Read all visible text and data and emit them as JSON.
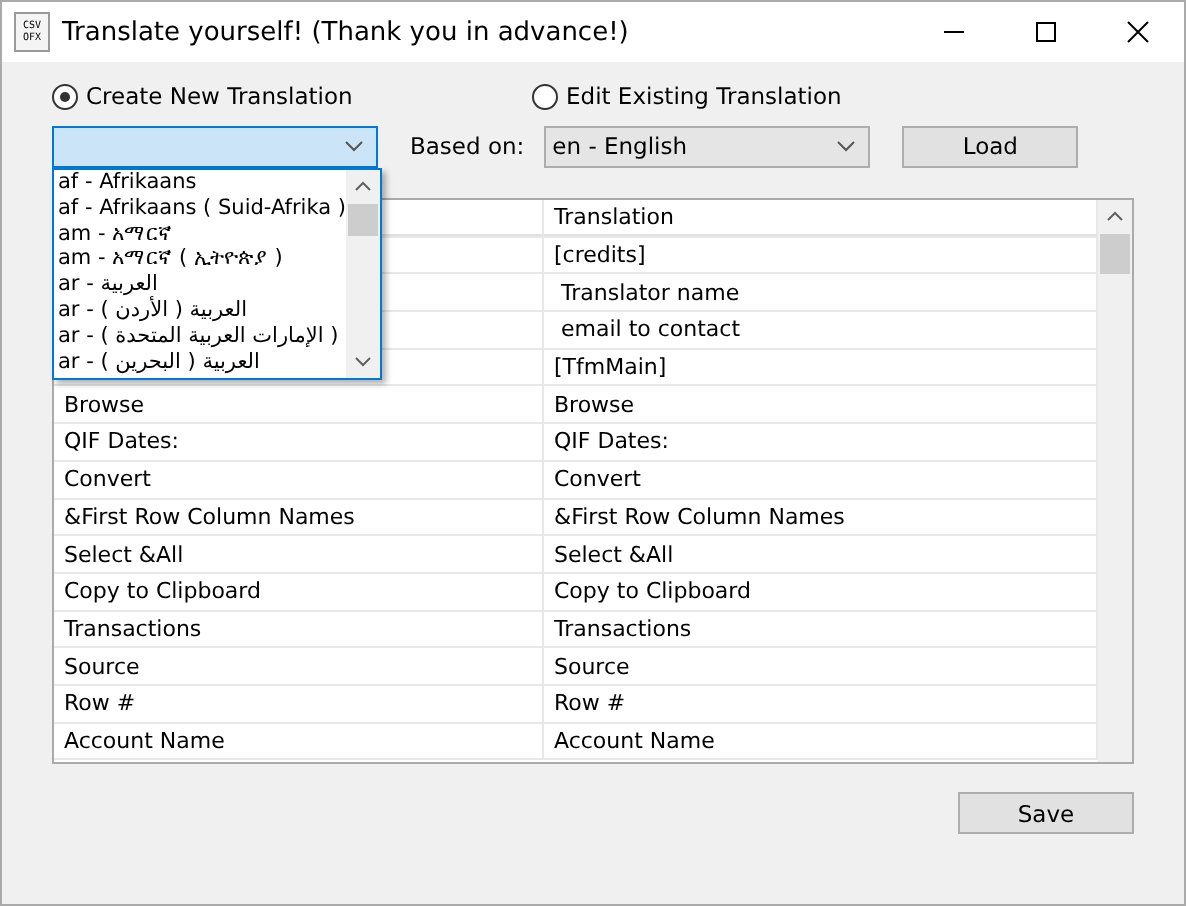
{
  "window": {
    "title": "Translate yourself! (Thank you in advance!)",
    "icon_lines": [
      "CSV",
      "OFX"
    ]
  },
  "modes": [
    {
      "label": "Create New Translation",
      "selected": true
    },
    {
      "label": "Edit Existing Translation",
      "selected": false
    }
  ],
  "new_language": {
    "expanded": true,
    "options": [
      {
        "label": "af - Afrikaans"
      },
      {
        "label": "af - Afrikaans ( Suid-Afrika )"
      },
      {
        "label": "am - አማርኛ"
      },
      {
        "label": "am - አማርኛ ( ኢትዮጵያ )"
      },
      {
        "label": "ar - العربية"
      },
      {
        "label": "ar - العربية ( الأردن )"
      },
      {
        "label": "ar - ( الإمارات العربية المتحدة )"
      },
      {
        "label": "ar - العربية ( البحرين )"
      }
    ]
  },
  "based_on": {
    "label": "Based on:",
    "value": "en - English"
  },
  "load_button": "Load",
  "table": {
    "columns": [
      "Translation"
    ],
    "rows": [
      {
        "translation": "[credits]"
      },
      {
        "translation": " Translator name"
      },
      {
        "translation": " email to contact"
      },
      {
        "translation": "[TfmMain]"
      },
      {
        "original": "Browse",
        "translation": "Browse"
      },
      {
        "original": "QIF Dates:",
        "translation": "QIF Dates:"
      },
      {
        "original": "Convert",
        "translation": "Convert"
      },
      {
        "original": "&First Row Column Names",
        "translation": "&First Row Column Names"
      },
      {
        "original": "Select &All",
        "translation": "Select &All"
      },
      {
        "original": "Copy to Clipboard",
        "translation": "Copy to Clipboard"
      },
      {
        "original": "Transactions",
        "translation": "Transactions"
      },
      {
        "original": "Source",
        "translation": "Source"
      },
      {
        "original": "Row #",
        "translation": "Row #"
      },
      {
        "original": "Account Name",
        "translation": "Account Name"
      }
    ]
  },
  "save_button": "Save"
}
